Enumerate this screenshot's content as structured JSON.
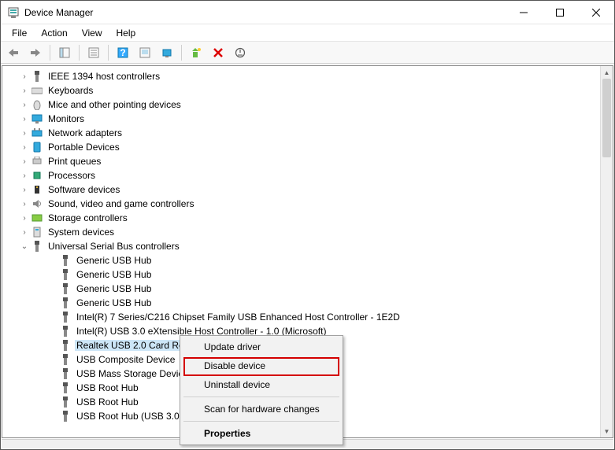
{
  "window": {
    "title": "Device Manager"
  },
  "menus": {
    "file": "File",
    "action": "Action",
    "view": "View",
    "help": "Help"
  },
  "categories": [
    {
      "name": "IEEE 1394 host controllers",
      "icon": "usb"
    },
    {
      "name": "Keyboards",
      "icon": "keyboard"
    },
    {
      "name": "Mice and other pointing devices",
      "icon": "mouse"
    },
    {
      "name": "Monitors",
      "icon": "monitor"
    },
    {
      "name": "Network adapters",
      "icon": "network"
    },
    {
      "name": "Portable Devices",
      "icon": "portable"
    },
    {
      "name": "Print queues",
      "icon": "printer"
    },
    {
      "name": "Processors",
      "icon": "cpu"
    },
    {
      "name": "Software devices",
      "icon": "software"
    },
    {
      "name": "Sound, video and game controllers",
      "icon": "sound"
    },
    {
      "name": "Storage controllers",
      "icon": "storage"
    },
    {
      "name": "System devices",
      "icon": "system"
    }
  ],
  "usb_category": "Universal Serial Bus controllers",
  "usb_devices": [
    "Generic USB Hub",
    "Generic USB Hub",
    "Generic USB Hub",
    "Generic USB Hub",
    "Intel(R) 7 Series/C216 Chipset Family USB Enhanced Host Controller - 1E2D",
    "Intel(R) USB 3.0 eXtensible Host Controller - 1.0 (Microsoft)",
    "Realtek USB 2.0 Card Reader",
    "USB Composite Device",
    "USB Mass Storage Device",
    "USB Root Hub",
    "USB Root Hub",
    "USB Root Hub (USB 3.0)"
  ],
  "selected_index": 6,
  "context_menu": {
    "update": "Update driver",
    "disable": "Disable device",
    "uninstall": "Uninstall device",
    "scan": "Scan for hardware changes",
    "properties": "Properties"
  }
}
